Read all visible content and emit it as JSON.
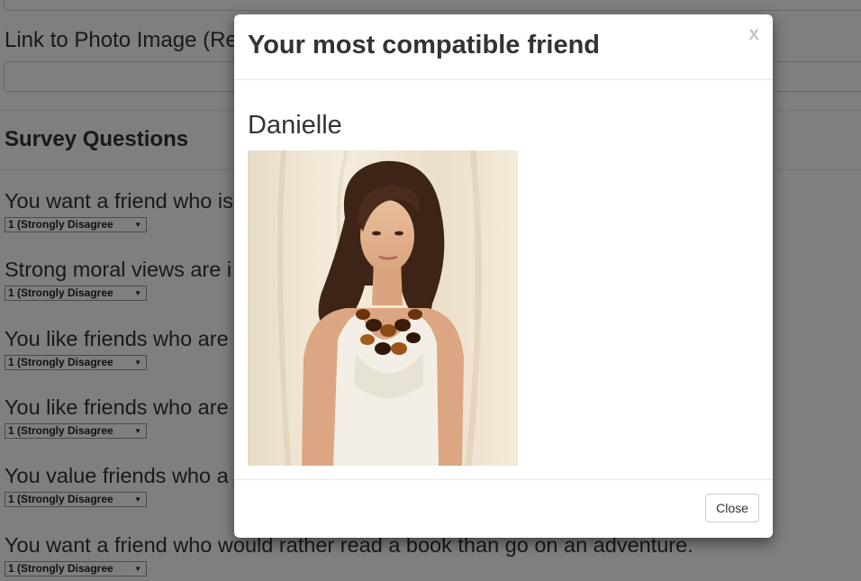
{
  "form": {
    "photo_label": "Link to Photo Image (Re",
    "survey_title": "Survey Questions"
  },
  "questions": [
    {
      "text": "You want a friend who is",
      "select": "1 (Strongly Disagree"
    },
    {
      "text": "Strong moral views are i",
      "select": "1 (Strongly Disagree"
    },
    {
      "text": "You like friends who are",
      "select": "1 (Strongly Disagree"
    },
    {
      "text": "You like friends who are",
      "select": "1 (Strongly Disagree"
    },
    {
      "text": "You value friends who a",
      "select": "1 (Strongly Disagree"
    },
    {
      "text": "You want a friend who would rather read a book than go on an adventure.",
      "select": "1 (Strongly Disagree"
    }
  ],
  "modal": {
    "title": "Your most compatible friend",
    "close_x": "x",
    "friend_name": "Danielle",
    "close_button": "Close"
  },
  "colors": {
    "backdrop": "#000000",
    "photo_background": "#efe3cf",
    "dress": "#f3efe6",
    "hair": "#3d2417",
    "necklace": "#6b3410"
  },
  "icons": {
    "select_arrow": "triangle-down",
    "close": "x-glyph"
  }
}
